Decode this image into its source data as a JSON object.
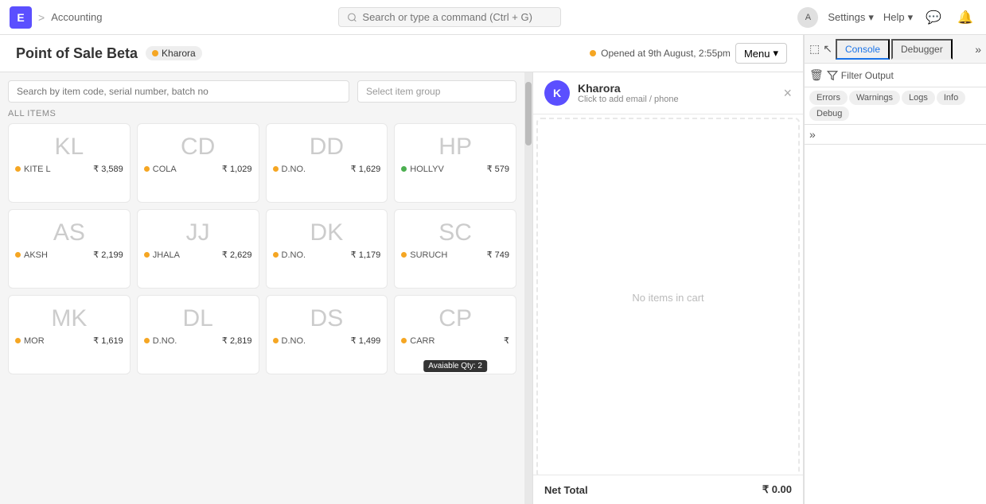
{
  "topbar": {
    "app_icon": "E",
    "breadcrumb_sep": ">",
    "breadcrumb": "Accounting",
    "search_placeholder": "Search or type a command (Ctrl + G)",
    "user_avatar": "A",
    "settings_label": "Settings",
    "help_label": "Help"
  },
  "pos": {
    "title": "Point of Sale Beta",
    "shop": "Kharora",
    "session_text": "Opened at 9th August, 2:55pm",
    "menu_label": "Menu",
    "item_search_placeholder": "Search by item code, serial number, batch no",
    "item_group_placeholder": "Select item group",
    "all_items_label": "ALL ITEMS"
  },
  "items": [
    {
      "abbr": "KL",
      "name": "KITE L",
      "price": "₹ 3,589",
      "dot": "orange"
    },
    {
      "abbr": "CD",
      "name": "COLA",
      "price": "₹ 1,029",
      "dot": "orange"
    },
    {
      "abbr": "DD",
      "name": "D.NO.",
      "price": "₹ 1,629",
      "dot": "orange"
    },
    {
      "abbr": "HP",
      "name": "HOLLYV",
      "price": "₹ 579",
      "dot": "green"
    },
    {
      "abbr": "AS",
      "name": "AKSH",
      "price": "₹ 2,199",
      "dot": "orange"
    },
    {
      "abbr": "JJ",
      "name": "JHALA",
      "price": "₹ 2,629",
      "dot": "orange"
    },
    {
      "abbr": "DK",
      "name": "D.NO.",
      "price": "₹ 1,179",
      "dot": "orange"
    },
    {
      "abbr": "SC",
      "name": "SURUCH",
      "price": "₹ 749",
      "dot": "orange"
    },
    {
      "abbr": "MK",
      "name": "MOR",
      "price": "₹ 1,619",
      "dot": "orange"
    },
    {
      "abbr": "DL",
      "name": "D.NO.",
      "price": "₹ 2,819",
      "dot": "orange"
    },
    {
      "abbr": "DS",
      "name": "D.NO.",
      "price": "₹ 1,499",
      "dot": "orange"
    },
    {
      "abbr": "CP",
      "name": "CARR",
      "price": "₹",
      "dot": "orange",
      "tooltip": "Avaiable Qty: 2"
    }
  ],
  "cart": {
    "customer_avatar": "K",
    "customer_name": "Kharora",
    "customer_sub": "Click to add email / phone",
    "empty_text": "No items in cart",
    "net_total_label": "Net Total",
    "net_total_value": "₹ 0.00"
  },
  "devtools": {
    "tabs": [
      {
        "label": "Console",
        "active": true
      },
      {
        "label": "Debugger",
        "active": false
      }
    ],
    "filter_output_label": "Filter Output",
    "filter_tabs": [
      {
        "label": "Errors",
        "active": false
      },
      {
        "label": "Warnings",
        "active": false
      },
      {
        "label": "Logs",
        "active": false
      },
      {
        "label": "Info",
        "active": false
      },
      {
        "label": "Debug",
        "active": false
      }
    ],
    "collapse_label": "»"
  }
}
